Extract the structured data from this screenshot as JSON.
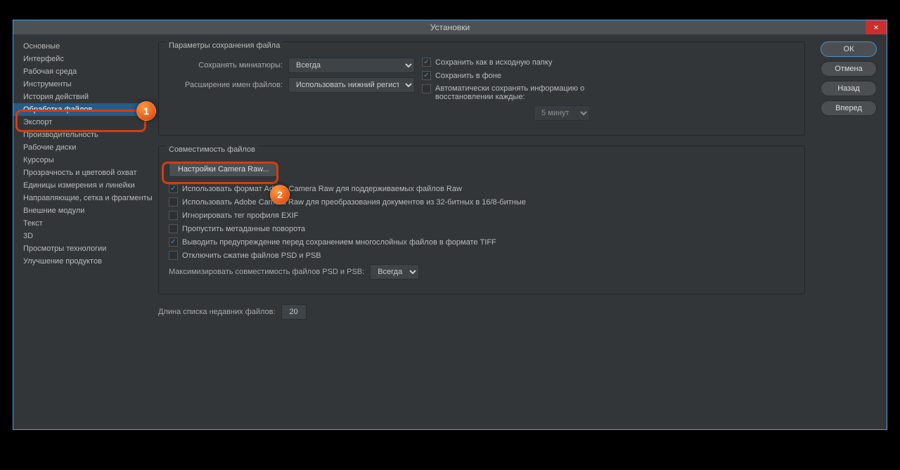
{
  "title": "Установки",
  "sidebar": {
    "items": [
      "Основные",
      "Интерфейс",
      "Рабочая среда",
      "Инструменты",
      "История действий",
      "Обработка файлов",
      "Экспорт",
      "Производительность",
      "Рабочие диски",
      "Курсоры",
      "Прозрачность и цветовой охват",
      "Единицы измерения и линейки",
      "Направляющие, сетка и фрагменты",
      "Внешние модули",
      "Текст",
      "3D",
      "Просмотры технологии",
      "Улучшение продуктов"
    ],
    "activeIndex": 5
  },
  "actions": {
    "ok": "ОК",
    "cancel": "Отмена",
    "back": "Назад",
    "forward": "Вперед"
  },
  "save_group": {
    "title": "Параметры сохранения файла",
    "thumb_label": "Сохранять миниатюры:",
    "thumb_value": "Всегда",
    "ext_label": "Расширение имен файлов:",
    "ext_value": "Использовать нижний регистр",
    "cb_original": "Сохранить как в исходную папку",
    "cb_background": "Сохранить в фоне",
    "cb_auto": "Автоматически сохранять информацию о восстановлении каждые:",
    "interval": "5 минут"
  },
  "compat_group": {
    "title": "Совместимость файлов",
    "camera_raw_btn": "Настройки Camera Raw...",
    "cb_use_raw": "Использовать формат Adobe Camera Raw для поддерживаемых файлов Raw",
    "cb_32bit": "Использовать Adobe Camera Raw для преобразования документов из 32-битных в 16/8-битные",
    "cb_exif": "Игнорировать тег профиля EXIF",
    "cb_rotate": "Пропустить метаданные поворота",
    "cb_tiff": "Выводить предупреждение перед сохранением многослойных файлов в формате TIFF",
    "cb_compress": "Отключить сжатие файлов PSD и PSB",
    "max_label": "Максимизировать совместимость файлов PSD и PSB:",
    "max_value": "Всегда"
  },
  "recent": {
    "label": "Длина списка недавних файлов:",
    "value": "20"
  },
  "callouts": {
    "one": "1",
    "two": "2"
  }
}
